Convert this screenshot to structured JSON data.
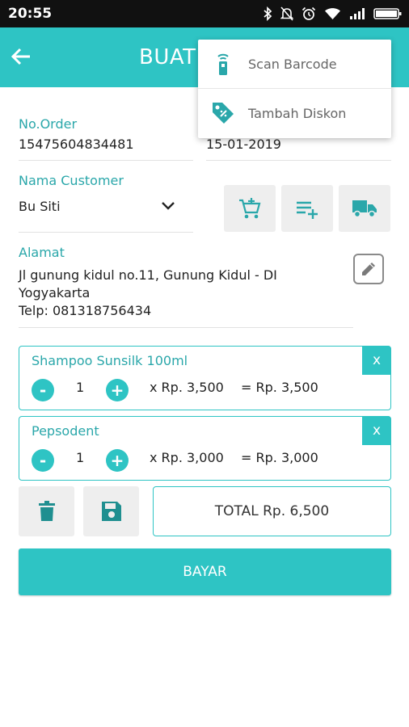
{
  "status_bar": {
    "time": "20:55"
  },
  "app_bar": {
    "title": "BUAT"
  },
  "form": {
    "order_label": "No.Order",
    "order_value": "15475604834481",
    "date_value": "15-01-2019",
    "customer_label": "Nama Customer",
    "customer_value": "Bu Siti",
    "address_label": "Alamat",
    "address_line1": "Jl gunung kidul no.11, Gunung Kidul - DI",
    "address_line2": "Yogyakarta",
    "address_phone": "Telp: 081318756434"
  },
  "items": [
    {
      "name": "Shampoo Sunsilk 100ml",
      "qty": "1",
      "price": "x Rp. 3,500",
      "subtotal": "= Rp. 3,500",
      "remove": "x",
      "minus": "-",
      "plus": "+"
    },
    {
      "name": "Pepsodent",
      "qty": "1",
      "price": "x Rp. 3,000",
      "subtotal": "= Rp. 3,000",
      "remove": "x",
      "minus": "-",
      "plus": "+"
    }
  ],
  "total_label": "TOTAL Rp. 6,500",
  "pay_button": "BAYAR",
  "popup_menu": {
    "items": [
      {
        "label": "Scan Barcode",
        "icon": "barcode-scanner-icon"
      },
      {
        "label": "Tambah Diskon",
        "icon": "discount-tag-icon"
      }
    ]
  },
  "colors": {
    "accent": "#2ec4c4",
    "label": "#2aa7aa",
    "status_bar": "#111111"
  }
}
